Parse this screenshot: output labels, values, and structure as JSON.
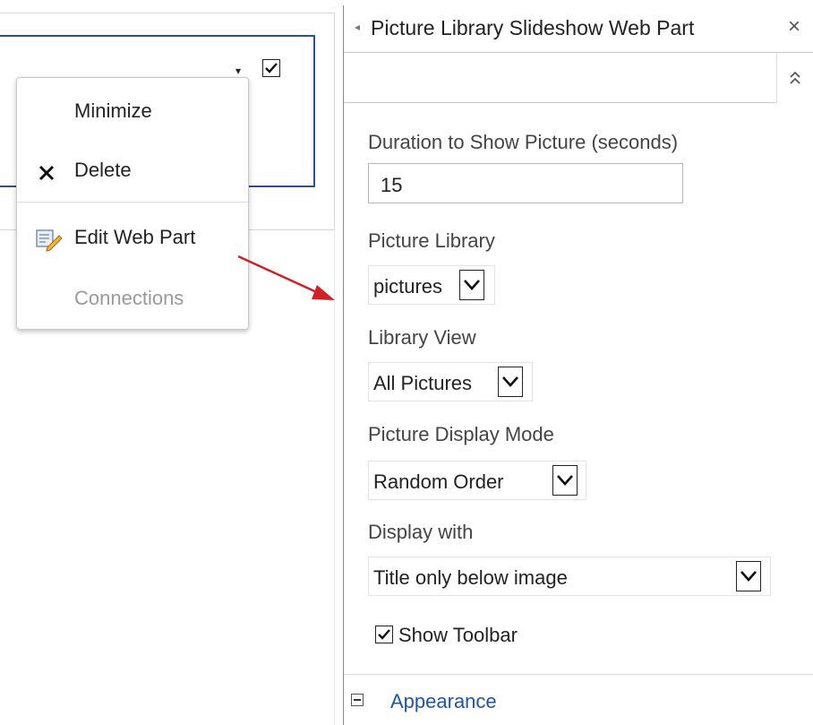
{
  "webpart": {
    "dropdown_arrow": "▾",
    "checkbox_checked": true
  },
  "context_menu": {
    "items": [
      {
        "label": "Minimize",
        "icon": "",
        "enabled": true
      },
      {
        "label": "Delete",
        "icon": "close-x-icon",
        "enabled": true
      },
      {
        "label": "Edit Web Part",
        "icon": "edit-web-part-icon",
        "enabled": true
      },
      {
        "label": "Connections",
        "icon": "",
        "enabled": false
      }
    ]
  },
  "tool_pane": {
    "back_arrow": "◂",
    "title": "Picture Library Slideshow Web Part",
    "close_label": "×",
    "collapse_label": "⌃⌃",
    "fields": {
      "duration": {
        "label": "Duration to Show Picture (seconds)",
        "value": "15"
      },
      "picture_library": {
        "label": "Picture Library",
        "value": "pictures"
      },
      "library_view": {
        "label": "Library View",
        "value": "All Pictures"
      },
      "display_mode": {
        "label": "Picture Display Mode",
        "value": "Random Order"
      },
      "display_with": {
        "label": "Display with",
        "value": "Title only below image"
      }
    },
    "show_toolbar": {
      "label": "Show Toolbar",
      "checked": true
    },
    "appearance": {
      "toggle": "−",
      "label": "Appearance"
    }
  },
  "colors": {
    "accent_blue": "#1f57a4",
    "frame_blue": "#2b4f9a",
    "arrow_red": "#d32027"
  }
}
